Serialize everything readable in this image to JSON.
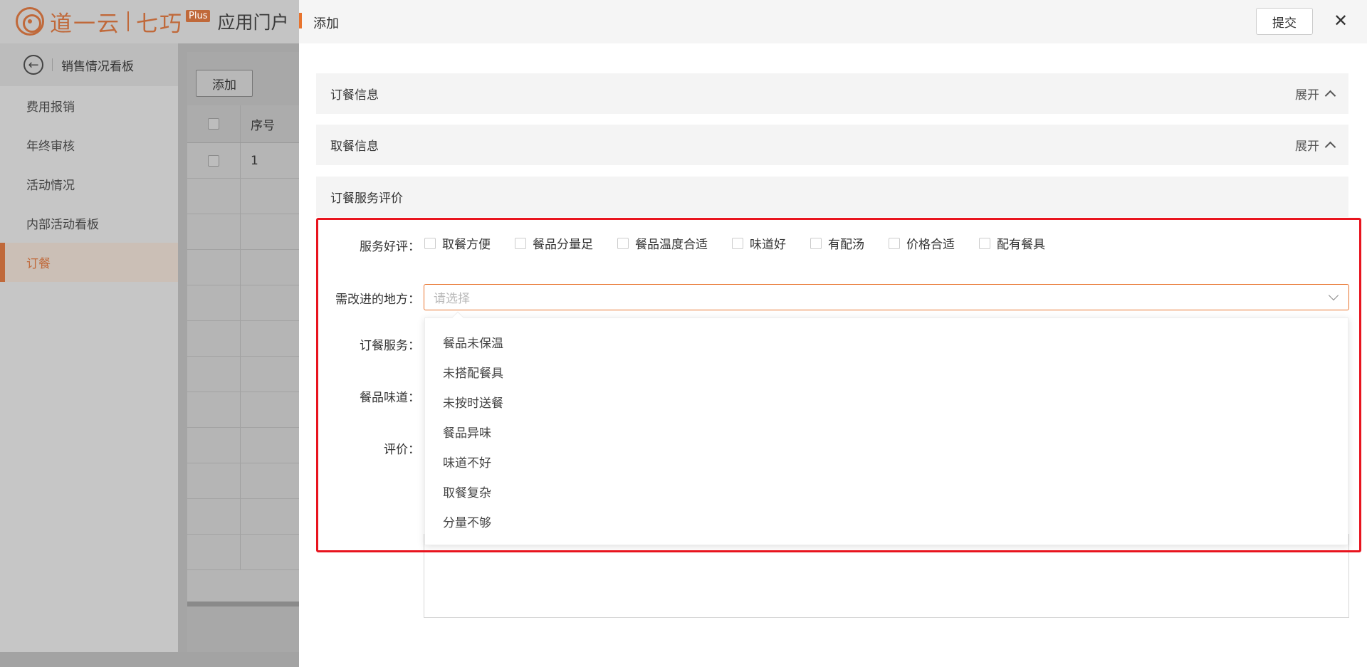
{
  "header": {
    "logo_brand": "道一云",
    "logo_product": "七巧",
    "logo_badge": "Plus",
    "portal_title": "应用门户"
  },
  "sidebar": {
    "back_title": "销售情况看板",
    "items": [
      {
        "label": "费用报销"
      },
      {
        "label": "年终审核"
      },
      {
        "label": "活动情况"
      },
      {
        "label": "内部活动看板"
      },
      {
        "label": "订餐"
      }
    ],
    "active_index": 4
  },
  "background_table": {
    "add_label": "添加",
    "column_index": "序号",
    "row1_index": "1"
  },
  "drawer": {
    "title": "添加",
    "submit_label": "提交",
    "sections": [
      {
        "title": "订餐信息",
        "expand_label": "展开"
      },
      {
        "title": "取餐信息",
        "expand_label": "展开"
      },
      {
        "title": "订餐服务评价"
      }
    ],
    "form": {
      "service_praise_label": "服务好评：",
      "service_praise_options": [
        "取餐方便",
        "餐品分量足",
        "餐品温度合适",
        "味道好",
        "有配汤",
        "价格合适",
        "配有餐具"
      ],
      "improve_label": "需改进的地方：",
      "improve_placeholder": "请选择",
      "improve_options": [
        "餐品未保温",
        "未搭配餐具",
        "未按时送餐",
        "餐品异味",
        "味道不好",
        "取餐复杂",
        "分量不够"
      ],
      "order_service_label": "订餐服务：",
      "taste_label": "餐品味道：",
      "review_label": "评价："
    }
  },
  "colors": {
    "accent": "#e8742e",
    "highlight": "#e8141e"
  }
}
